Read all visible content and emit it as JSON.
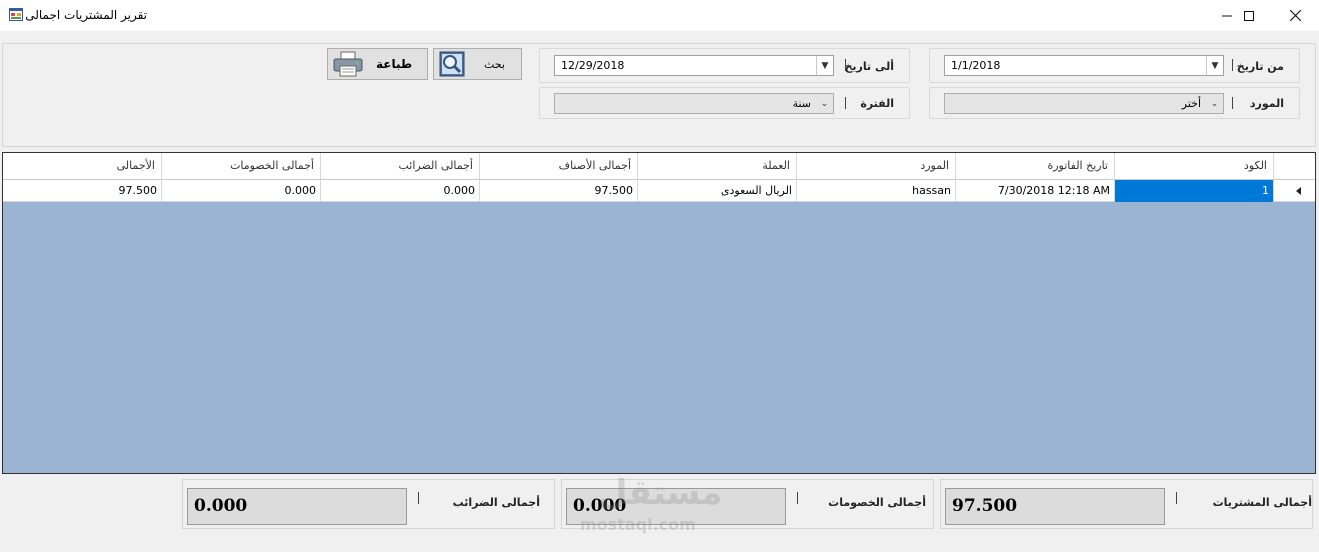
{
  "window": {
    "title": "تقرير المشتريات اجمالى",
    "controls": [
      "minimize-icon",
      "maximize-icon",
      "close-icon"
    ]
  },
  "filters": {
    "from_date": {
      "label": "من تاريخ",
      "value": "1/1/2018"
    },
    "to_date": {
      "label": "ألى تاريخ",
      "value": "12/29/2018"
    },
    "supplier": {
      "label": "المورد",
      "value": "أختر"
    },
    "period": {
      "label": "الفترة",
      "value": "سنة"
    },
    "search_button": "بحث",
    "print_button": "طباعة"
  },
  "grid": {
    "columns": [
      "الكود",
      "تاريخ الفاتورة",
      "المورد",
      "العملة",
      "أجمالى الأصناف",
      "أجمالى الضرائب",
      "أجمالى الخصومات",
      "الأجمالى"
    ],
    "rows": [
      {
        "code": "1",
        "invoice_date": "7/30/2018 12:18 AM",
        "supplier": "hassan",
        "currency": "الريال السعودى",
        "items_total": "97.500",
        "tax_total": "0.000",
        "discount_total": "0.000",
        "grand_total": "97.500"
      }
    ],
    "empty_area_color": "#9bb4d1",
    "selection_color": "#0078d7"
  },
  "totals": {
    "purchases": {
      "label": "أجمالى المشتريات",
      "value": "97.500"
    },
    "discounts": {
      "label": "أجمالى الخصومات",
      "value": "0.000"
    },
    "taxes": {
      "label": "أجمالى الضرائب",
      "value": "0.000"
    }
  },
  "watermark": {
    "text": "مستقل",
    "subtext": "mostaql.com"
  }
}
